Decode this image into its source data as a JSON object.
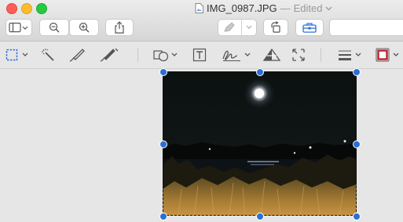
{
  "window": {
    "filename": "IMG_0987.JPG",
    "separator": "—",
    "status": "Edited"
  },
  "icons": {
    "sidebar": "sidebar-icon",
    "zoom_out": "zoom-out-icon",
    "zoom_in": "zoom-in-icon",
    "share": "share-icon",
    "markup": "markup-pen-icon",
    "rotate": "rotate-icon",
    "toolbox": "toolbox-icon"
  },
  "colors": {
    "accent": "#2b6fd6",
    "close": "#fc5f57",
    "minimize": "#fdbc2e",
    "maximize": "#28c840",
    "border_color_tool": "#c0262d"
  }
}
